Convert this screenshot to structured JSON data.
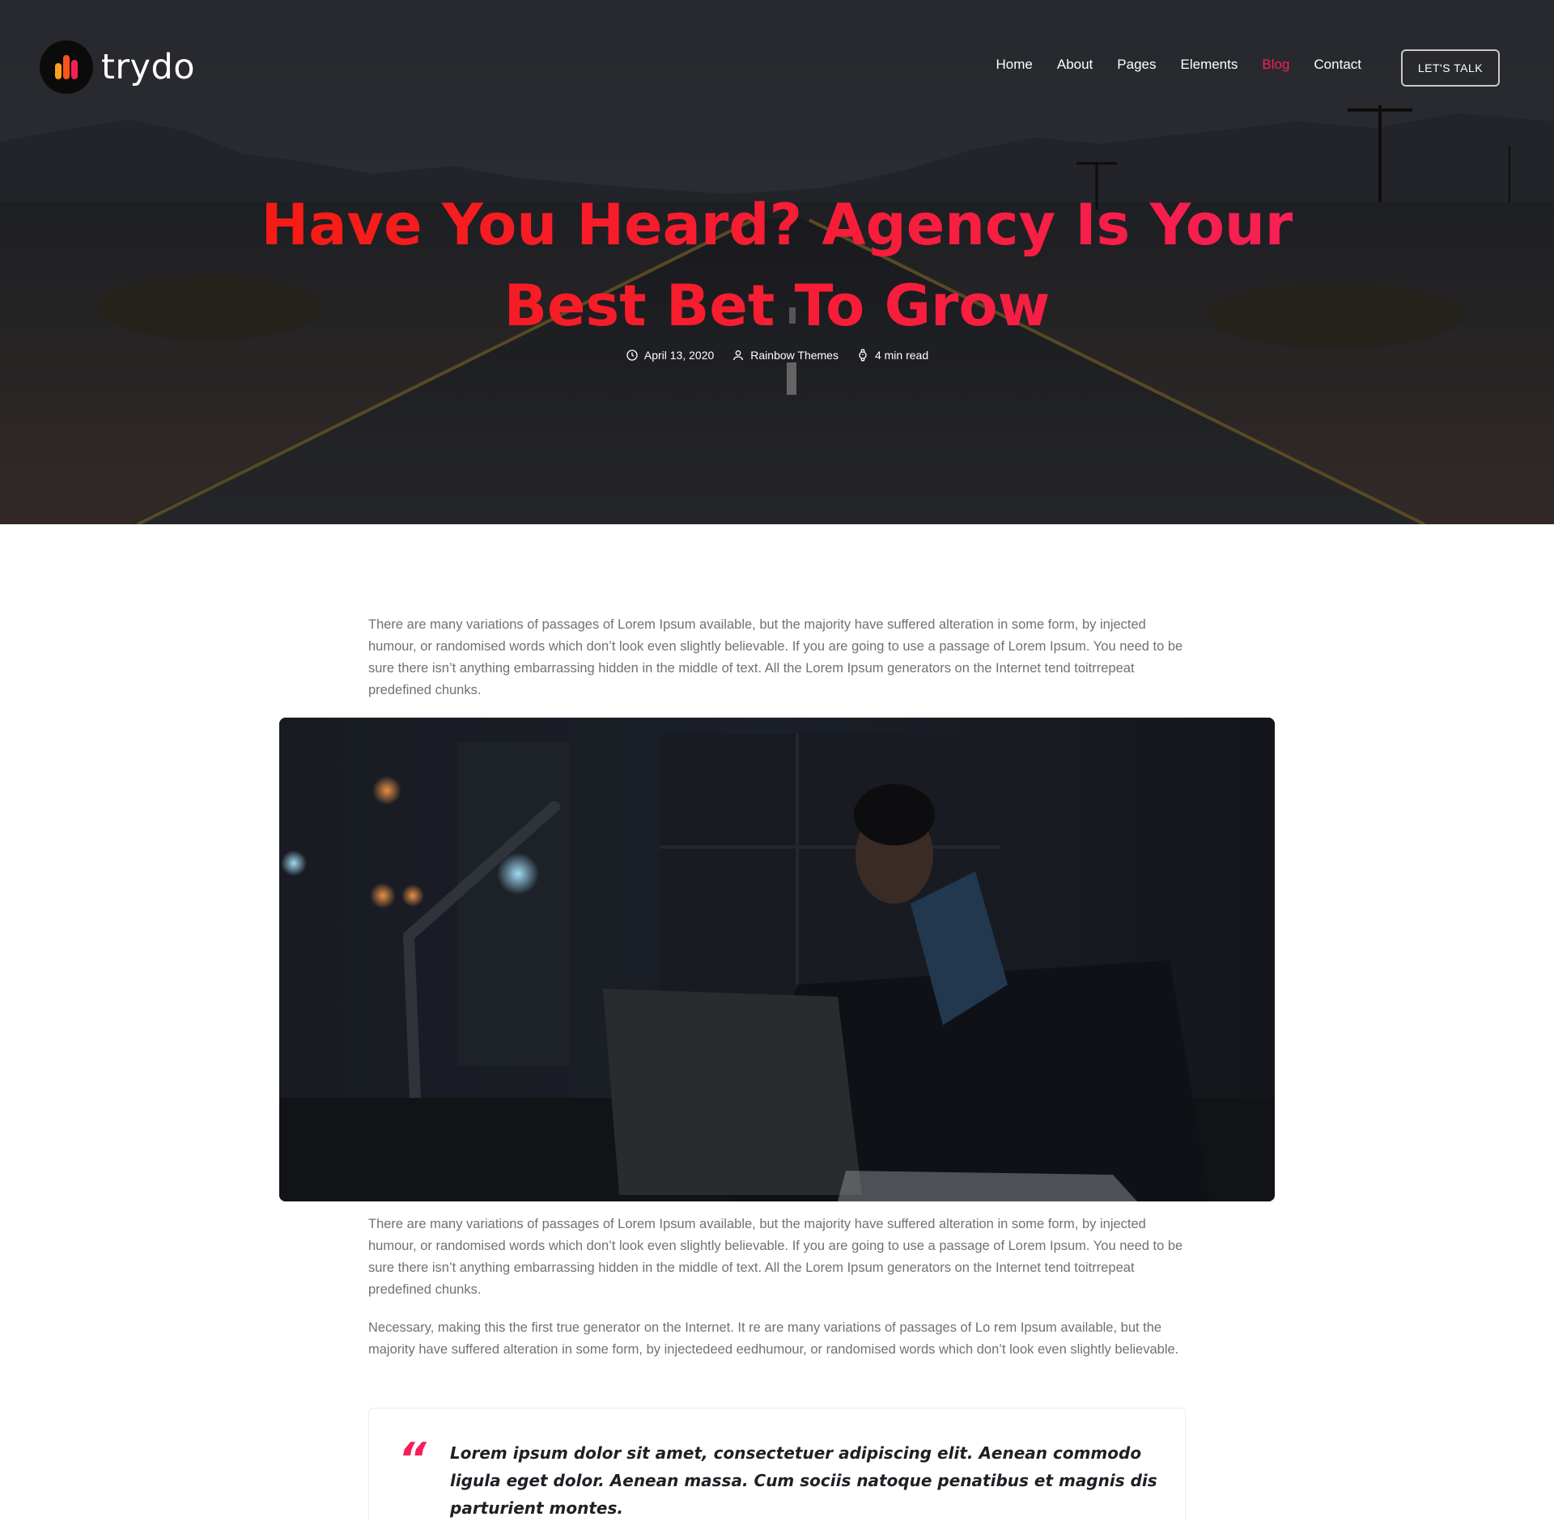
{
  "header": {
    "brand": "trydo",
    "nav": [
      {
        "label": "Home",
        "active": false
      },
      {
        "label": "About",
        "active": false
      },
      {
        "label": "Pages",
        "active": false
      },
      {
        "label": "Elements",
        "active": false
      },
      {
        "label": "Blog",
        "active": true
      },
      {
        "label": "Contact",
        "active": false
      }
    ],
    "cta_label": "LET'S TALK"
  },
  "hero": {
    "title_line1": "Have You Heard? Agency Is Your",
    "title_line2": "Best Bet To Grow",
    "meta": {
      "date": "April 13, 2020",
      "author": "Rainbow Themes",
      "read_time": "4 min read"
    }
  },
  "article": {
    "paragraph1": "There are many variations of passages of Lorem Ipsum available, but the majority have suffered alteration in some form, by injected humour, or randomised words which don’t look even slightly believable. If you are going to use a passage of Lorem Ipsum. You need to be sure there isn’t anything embarrassing hidden in the middle of text. All the Lorem Ipsum generators on the Internet tend toitrrepeat predefined chunks.",
    "paragraph2": "There are many variations of passages of Lorem Ipsum available, but the majority have suffered alteration in some form, by injected humour, or randomised words which don’t look even slightly believable. If you are going to use a passage of Lorem Ipsum. You need to be sure there isn’t anything embarrassing hidden in the middle of text. All the Lorem Ipsum generators on the Internet tend toitrrepeat predefined chunks.",
    "paragraph3": "Necessary, making this the first true generator on the Internet. It re are many variations of passages of Lo rem Ipsum available, but the majority have suffered alteration in some form, by injectedeed eedhumour, or randomised words which don’t look even slightly believable.",
    "quote": "Lorem ipsum dolor sit amet, consectetuer adipiscing elit. Aenean commodo ligula eget dolor. Aenean massa. Cum sociis natoque penatibus et magnis dis parturient montes."
  },
  "colors": {
    "accent": "#f81f58",
    "accent_start": "#f61b10",
    "body_text": "#717173",
    "heading_text": "#1f1f25"
  }
}
